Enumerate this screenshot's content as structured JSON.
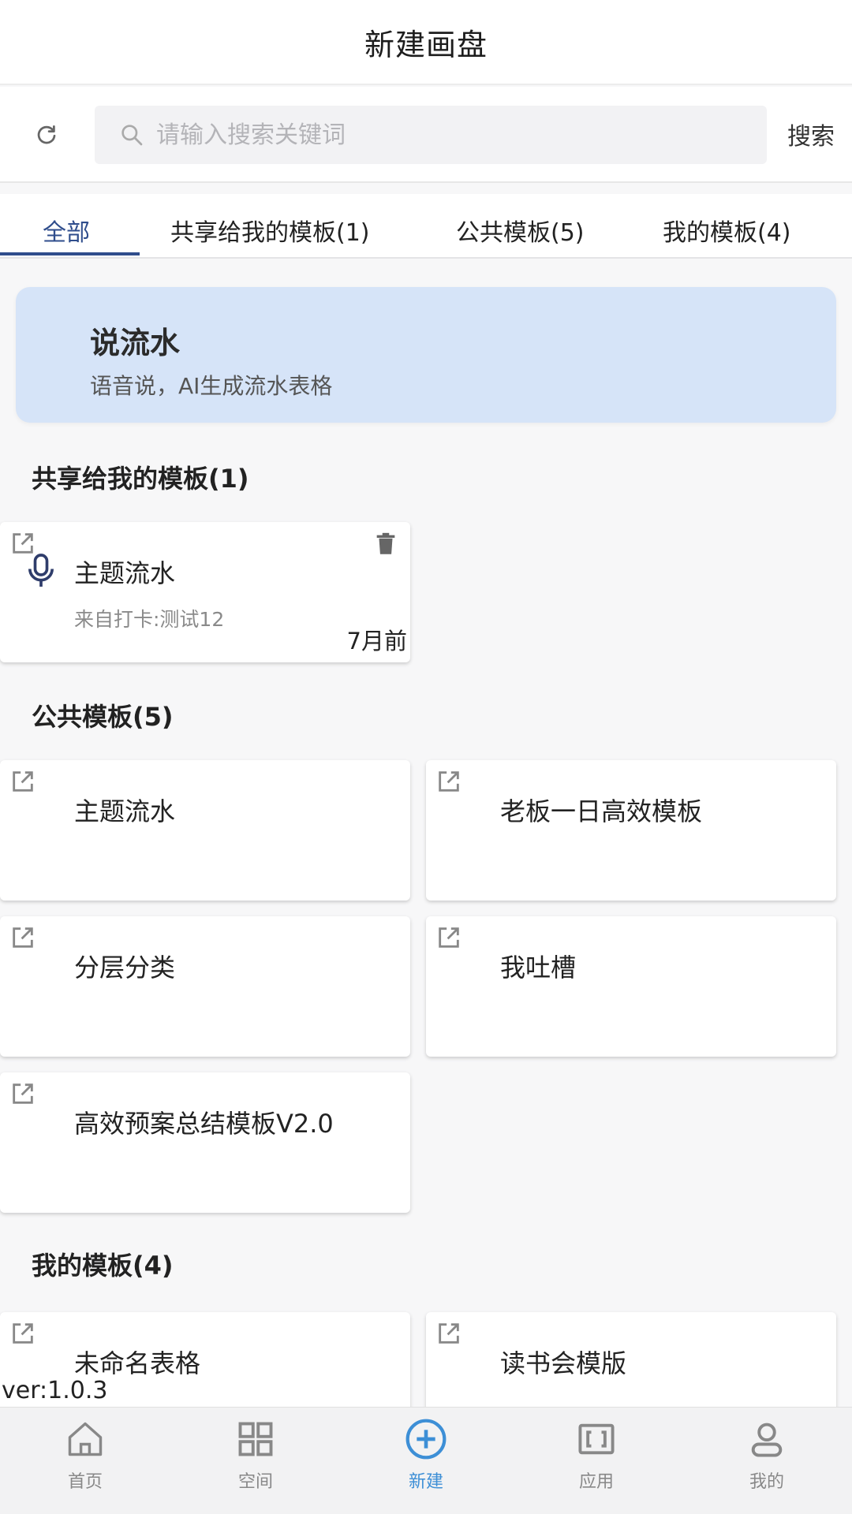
{
  "header": {
    "title": "新建画盘"
  },
  "search": {
    "placeholder": "请输入搜索关键词",
    "button_label": "搜索"
  },
  "tabs": [
    {
      "label": "全部",
      "active": true
    },
    {
      "label": "共享给我的模板(1)",
      "active": false
    },
    {
      "label": "公共模板(5)",
      "active": false
    },
    {
      "label": "我的模板(4)",
      "active": false
    }
  ],
  "banner": {
    "title": "说流水",
    "subtitle": "语音说，AI生成流水表格"
  },
  "sections": {
    "shared": {
      "title": "共享给我的模板(1)",
      "items": [
        {
          "name": "主题流水",
          "from": "来自打卡:测试12",
          "time": "7月前"
        }
      ]
    },
    "public": {
      "title": "公共模板(5)",
      "items": [
        {
          "name": "主题流水"
        },
        {
          "name": "老板一日高效模板"
        },
        {
          "name": "分层分类"
        },
        {
          "name": "我吐槽"
        },
        {
          "name": "高效预案总结模板V2.0"
        }
      ]
    },
    "mine": {
      "title": "我的模板(4)",
      "items": [
        {
          "name": "未命名表格"
        },
        {
          "name": "读书会模版"
        }
      ]
    }
  },
  "version": "ver:1.0.3",
  "bottom_nav": [
    {
      "label": "首页",
      "icon": "home-icon",
      "active": false
    },
    {
      "label": "空间",
      "icon": "grid-icon",
      "active": false
    },
    {
      "label": "新建",
      "icon": "plus-circle-icon",
      "active": true
    },
    {
      "label": "应用",
      "icon": "apps-icon",
      "active": false
    },
    {
      "label": "我的",
      "icon": "user-icon",
      "active": false
    }
  ],
  "colors": {
    "accent": "#2f4d8c",
    "banner_bg": "#d6e4f8",
    "nav_active": "#3d8fd6",
    "nav_inactive": "#888888"
  }
}
